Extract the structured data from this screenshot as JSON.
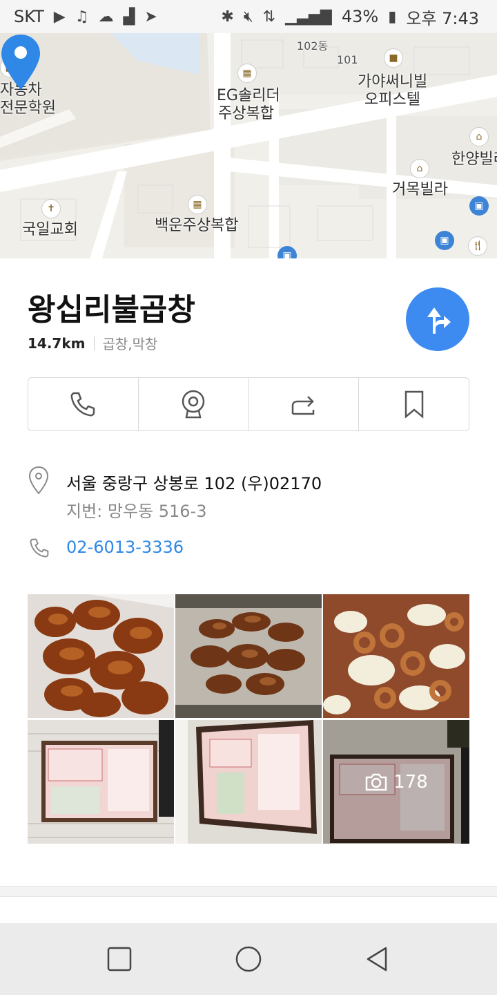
{
  "status_bar": {
    "carrier": "SKT",
    "battery": "43%",
    "time": "오후 7:43"
  },
  "map": {
    "labels": {
      "building_top": "102동",
      "building_101": "101",
      "driving_school_1": "자동차",
      "driving_school_2": "전문학원",
      "eg_1": "EG솔리더",
      "eg_2": "주상복합",
      "gaya_1": "가야써니빌",
      "gaya_2": "오피스텔",
      "hanyang": "한양빌라",
      "geomok": "거목빌라",
      "gukil": "국일교회",
      "baekun": "백운주상복합"
    }
  },
  "place": {
    "name": "왕십리불곱창",
    "distance": "14.7km",
    "category": "곱창,막창",
    "address": "서울 중랑구 상봉로 102 (우)02170",
    "jibun": "지번: 망우동 516-3",
    "phone": "02-6013-3336",
    "photo_count": "178"
  },
  "actions": [
    {
      "icon": "phone-icon"
    },
    {
      "icon": "street-view-icon"
    },
    {
      "icon": "share-icon"
    },
    {
      "icon": "bookmark-icon"
    }
  ],
  "colors": {
    "accent": "#3d8bf0",
    "phone_link": "#2f87e6",
    "pin": "#2f87e6"
  }
}
